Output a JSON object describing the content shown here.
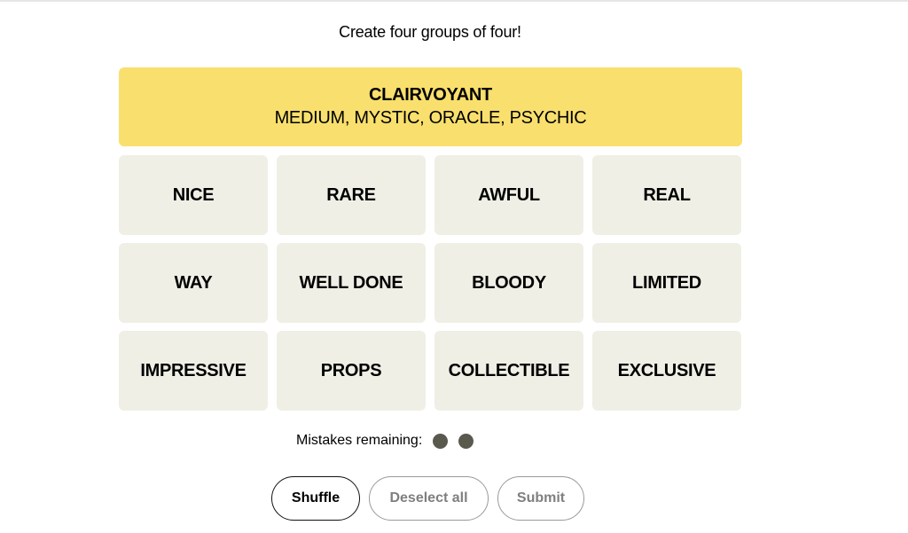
{
  "instructions": "Create four groups of four!",
  "solved_groups": [
    {
      "category": "CLAIRVOYANT",
      "members": "MEDIUM, MYSTIC, ORACLE, PSYCHIC",
      "color": "#f9df6d"
    }
  ],
  "tiles": [
    "NICE",
    "RARE",
    "AWFUL",
    "REAL",
    "WAY",
    "WELL DONE",
    "BLOODY",
    "LIMITED",
    "IMPRESSIVE",
    "PROPS",
    "COLLECTIBLE",
    "EXCLUSIVE"
  ],
  "mistakes": {
    "label": "Mistakes remaining:",
    "remaining": 2
  },
  "buttons": {
    "shuffle": "Shuffle",
    "deselect_all": "Deselect all",
    "submit": "Submit"
  },
  "colors": {
    "tile_bg": "#efefe6",
    "solved_yellow": "#f9df6d",
    "mistake_dot": "#5a594e"
  }
}
